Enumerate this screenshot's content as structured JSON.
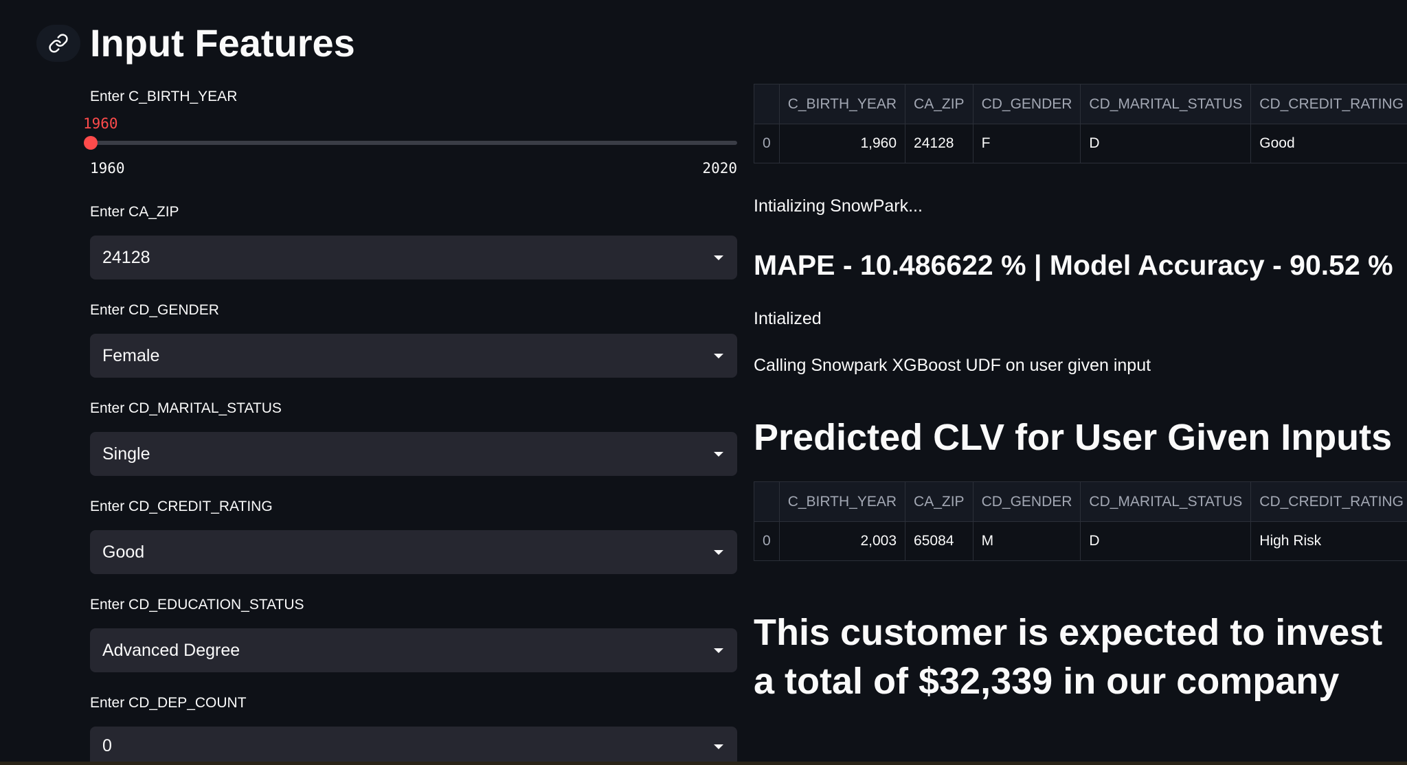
{
  "header": {
    "title": "Input Features",
    "anchor_icon": "link-icon"
  },
  "inputs": {
    "birth_year": {
      "label": "Enter C_BIRTH_YEAR",
      "value": "1960",
      "min": "1960",
      "max": "2020",
      "accent": "#ff4b4b"
    },
    "ca_zip": {
      "label": "Enter CA_ZIP",
      "value": "24128"
    },
    "gender": {
      "label": "Enter CD_GENDER",
      "value": "Female"
    },
    "marital_status": {
      "label": "Enter CD_MARITAL_STATUS",
      "value": "Single"
    },
    "credit_rating": {
      "label": "Enter CD_CREDIT_RATING",
      "value": "Good"
    },
    "education_status": {
      "label": "Enter CD_EDUCATION_STATUS",
      "value": "Advanced Degree"
    },
    "dep_count": {
      "label": "Enter CD_DEP_COUNT",
      "value": "0"
    }
  },
  "input_table": {
    "columns": [
      "",
      "C_BIRTH_YEAR",
      "CA_ZIP",
      "CD_GENDER",
      "CD_MARITAL_STATUS",
      "CD_CREDIT_RATING"
    ],
    "rows": [
      [
        "0",
        "1,960",
        "24128",
        "F",
        "D",
        "Good"
      ]
    ]
  },
  "status": {
    "initializing": "Intializing SnowPark...",
    "metrics": "MAPE - 10.486622 % | Model Accuracy - 90.52 %",
    "initialized": "Intialized",
    "calling": "Calling Snowpark XGBoost UDF on user given input"
  },
  "prediction": {
    "heading": "Predicted CLV for User Given Inputs",
    "table": {
      "columns": [
        "",
        "C_BIRTH_YEAR",
        "CA_ZIP",
        "CD_GENDER",
        "CD_MARITAL_STATUS",
        "CD_CREDIT_RATING"
      ],
      "rows": [
        [
          "0",
          "2,003",
          "65084",
          "M",
          "D",
          "High Risk"
        ]
      ]
    },
    "result": "This customer is expected to invest a total of $32,339 in our company"
  },
  "theme": {
    "background": "#0e1117",
    "widget": "#262730",
    "accent": "#ff4b4b"
  }
}
